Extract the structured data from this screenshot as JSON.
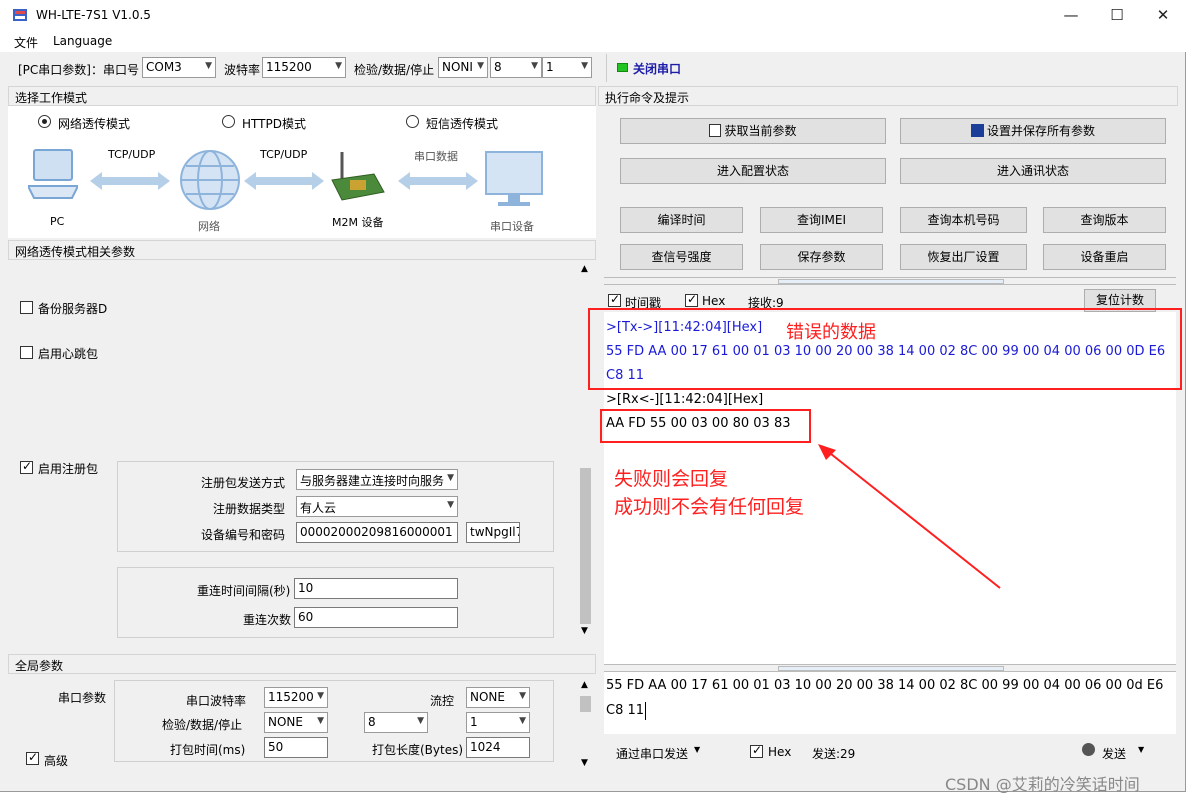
{
  "window": {
    "title": "WH-LTE-7S1 V1.0.5"
  },
  "menu": {
    "file": "文件",
    "language": "Language"
  },
  "toolbar": {
    "port_label": "[PC串口参数]：串口号",
    "port_value": "COM3",
    "baud_label": "波特率",
    "baud_value": "115200",
    "parity_label": "检验/数据/停止",
    "parity_value": "NONI",
    "databits_value": "8",
    "stopbits_value": "1",
    "close_port": "关闭串口"
  },
  "mode_panel": {
    "title": "选择工作模式",
    "modes": [
      "网络透传模式",
      "HTTPD模式",
      "短信透传模式"
    ],
    "diagram": {
      "pc": "PC",
      "link1": "TCP/UDP",
      "network": "网络",
      "link2": "TCP/UDP",
      "m2m": "M2M 设备",
      "link3": "串口数据",
      "serial_device": "串口设备"
    }
  },
  "net_params": {
    "title": "网络透传模式相关参数",
    "backup_server": "备份服务器D",
    "heartbeat": "启用心跳包",
    "register": "启用注册包",
    "reg_send_label": "注册包发送方式",
    "reg_send_value": "与服务器建立连接时向服务",
    "reg_type_label": "注册数据类型",
    "reg_type_value": "有人云",
    "dev_id_label": "设备编号和密码",
    "dev_id_value": "00002000209816000001",
    "dev_pwd_value": "twNpgIl7",
    "reconnect_interval_label": "重连时间间隔(秒)",
    "reconnect_interval_value": "10",
    "reconnect_count_label": "重连次数",
    "reconnect_count_value": "60"
  },
  "global_params": {
    "title": "全局参数",
    "serial_label": "串口参数",
    "baud_label": "串口波特率",
    "baud_value": "115200",
    "flow_label": "流控",
    "flow_value": "NONE",
    "parity_label": "检验/数据/停止",
    "parity_value": "NONE",
    "databits_value": "8",
    "stopbits_value": "1",
    "pack_time_label": "打包时间(ms)",
    "pack_time_value": "50",
    "pack_len_label": "打包长度(Bytes)",
    "pack_len_value": "1024",
    "advanced": "高级"
  },
  "cmd_panel": {
    "title": "执行命令及提示",
    "get_params": "获取当前参数",
    "save_all": "设置并保存所有参数",
    "enter_config": "进入配置状态",
    "enter_comm": "进入通讯状态",
    "btn_row1": [
      "编译时间",
      "查询IMEI",
      "查询本机号码",
      "查询版本"
    ],
    "btn_row2": [
      "查信号强度",
      "保存参数",
      "恢复出厂设置",
      "设备重启"
    ]
  },
  "log": {
    "timestamp": "时间戳",
    "hex": "Hex",
    "recv": "接收:9",
    "reset_count": "复位计数",
    "tx_header": ">[Tx->][11:42:04][Hex]",
    "tx_annotation": "错误的数据",
    "tx_line1": "55 FD AA 00 17 61 00 01 03 10 00 20 00 38 14 00 02 8C 00 99 00 04 00 06 00 0D E6",
    "tx_line2": "C8 11",
    "rx_header": ">[Rx<-][11:42:04][Hex]",
    "rx_line": "AA FD 55 00 03 00 80 03 83",
    "note1": "失败则会回复",
    "note2": "成功则不会有任何回复"
  },
  "send": {
    "line1": "55 FD AA 00 17 61 00 01 03 10 00 20 00 38 14 00 02 8C 00 99 00 04 00 06 00 0d E6",
    "line2": "C8 11",
    "via_serial": "通过串口发送",
    "hex": "Hex",
    "sent_count": "发送:29",
    "send_btn": "发送"
  },
  "watermark": "CSDN @艾莉的冷笑话时间",
  "colors": {
    "tx_text": "#1a1ad8",
    "annotation": "#ff1f1f",
    "green_led": "#22c422"
  }
}
